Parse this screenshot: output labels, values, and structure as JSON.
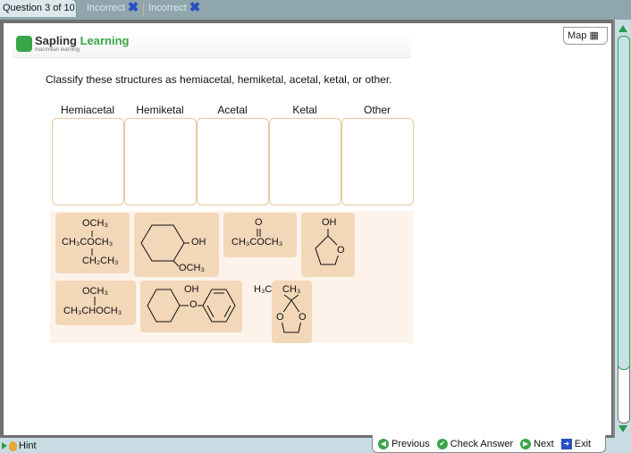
{
  "header": {
    "question_label": "Question 3 of 10",
    "attempts": [
      {
        "label": "Incorrect",
        "icon": "x-icon"
      },
      {
        "label": "Incorrect",
        "icon": "x-icon"
      }
    ]
  },
  "brand": {
    "name_a": "Sapling",
    "name_b": "Learning",
    "sub": "macmillan learning"
  },
  "map_label": "Map",
  "prompt": "Classify these structures as hemiacetal, hemiketal, acetal, ketal, or other.",
  "bins": [
    "Hemiacetal",
    "Hemiketal",
    "Acetal",
    "Ketal",
    "Other"
  ],
  "tiles": [
    {
      "name": "tile-1",
      "lines": [
        "OCH₃",
        "CH₃COCH₃",
        "CH₂CH₃"
      ]
    },
    {
      "name": "tile-2",
      "labels": [
        "OH",
        "OCH₃"
      ]
    },
    {
      "name": "tile-3",
      "lines": [
        "O",
        "CH₃COCH₃"
      ]
    },
    {
      "name": "tile-4",
      "labels": [
        "OH",
        "O"
      ]
    },
    {
      "name": "tile-5",
      "lines": [
        "OCH₃",
        "CH₃CHOCH₃"
      ]
    },
    {
      "name": "tile-6",
      "labels": [
        "OH",
        "O"
      ]
    },
    {
      "name": "tile-7",
      "labels": [
        "H₃C",
        "CH₃",
        "O",
        "O"
      ]
    }
  ],
  "footer": {
    "hint": "Hint",
    "previous": "Previous",
    "check": "Check Answer",
    "next": "Next",
    "exit": "Exit"
  }
}
